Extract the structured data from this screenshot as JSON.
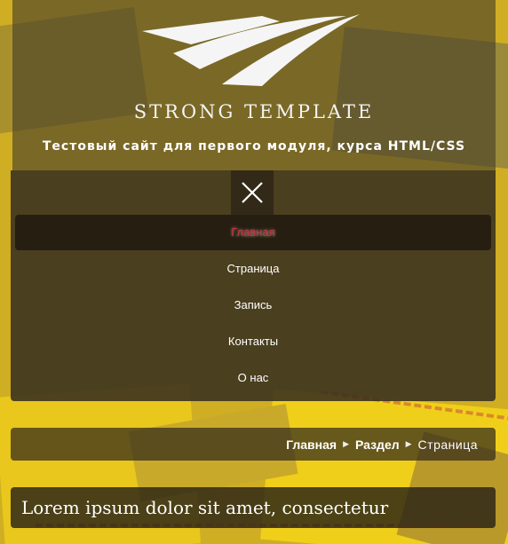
{
  "site": {
    "title": "STRONG TEMPLATE",
    "subtitle": "Тестовый сайт для первого модуля, курса HTML/CSS"
  },
  "menu": {
    "close_icon": "close-icon",
    "items": [
      {
        "label": "Главная",
        "active": true
      },
      {
        "label": "Страница",
        "active": false
      },
      {
        "label": "Запись",
        "active": false
      },
      {
        "label": "Контакты",
        "active": false
      },
      {
        "label": "О нас",
        "active": false
      }
    ]
  },
  "breadcrumb": {
    "items": [
      "Главная",
      "Раздел"
    ],
    "current": "Страница",
    "separator_icon": "caret-right-icon"
  },
  "content": {
    "heading": "Lorem ipsum dolor sit amet, consectetur"
  },
  "colors": {
    "active_menu": "#c8343c",
    "accent_yellow": "#e8c51f"
  }
}
